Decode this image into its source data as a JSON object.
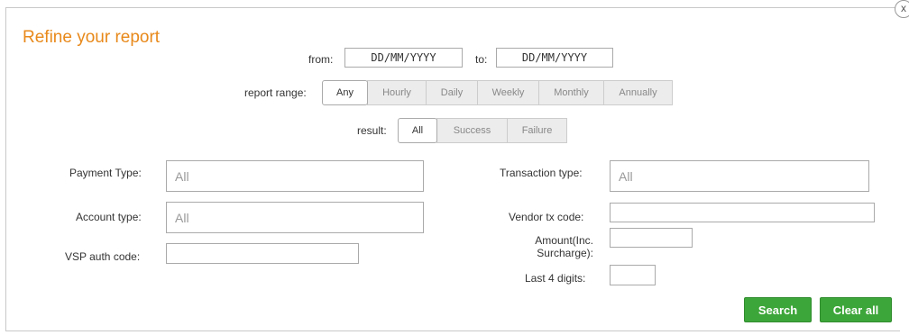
{
  "dialog": {
    "title": "Refine your report",
    "close_glyph": "x"
  },
  "date_range": {
    "from_label": "from:",
    "from_value": "DD/MM/YYYY",
    "to_label": "to:",
    "to_value": "DD/MM/YYYY"
  },
  "report_range": {
    "label": "report range:",
    "options": [
      "Any",
      "Hourly",
      "Daily",
      "Weekly",
      "Monthly",
      "Annually"
    ],
    "selected": "Any"
  },
  "result": {
    "label": "result:",
    "options": [
      "All",
      "Success",
      "Failure"
    ],
    "selected": "All"
  },
  "fields": {
    "payment_type_label": "Payment Type:",
    "payment_type_value": "All",
    "account_type_label": "Account type:",
    "account_type_value": "All",
    "vsp_auth_code_label": "VSP auth code:",
    "transaction_type_label": "Transaction type:",
    "transaction_type_value": "All",
    "vendor_tx_code_label": "Vendor tx code:",
    "amount_label_line1": "Amount(Inc.",
    "amount_label_line2": "Surcharge):",
    "last4_label": "Last 4 digits:"
  },
  "actions": {
    "search_label": "Search",
    "clear_label": "Clear all"
  },
  "colors": {
    "title": "#e8891b",
    "button_green": "#3da63a"
  }
}
